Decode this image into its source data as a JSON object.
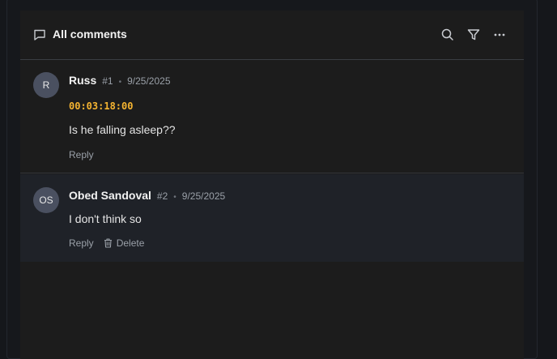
{
  "header": {
    "title": "All comments",
    "icons": [
      "comment-icon",
      "search-icon",
      "filter-icon",
      "more-icon"
    ]
  },
  "comments": [
    {
      "avatar": "R",
      "author": "Russ",
      "number": "#1",
      "separator": "•",
      "date": "9/25/2025",
      "timecode": "00:03:18:00",
      "text": "Is he falling asleep??",
      "reply_label": "Reply"
    },
    {
      "avatar": "OS",
      "author": "Obed Sandoval",
      "number": "#2",
      "separator": "•",
      "date": "9/25/2025",
      "text": "I don't think so",
      "reply_label": "Reply",
      "delete_label": "Delete"
    }
  ],
  "colors": {
    "timecode": "#f5b431",
    "panel": "#1c1c1c",
    "selected_comment_bg": "#1f2228",
    "avatar_bg": "#4a5060"
  }
}
